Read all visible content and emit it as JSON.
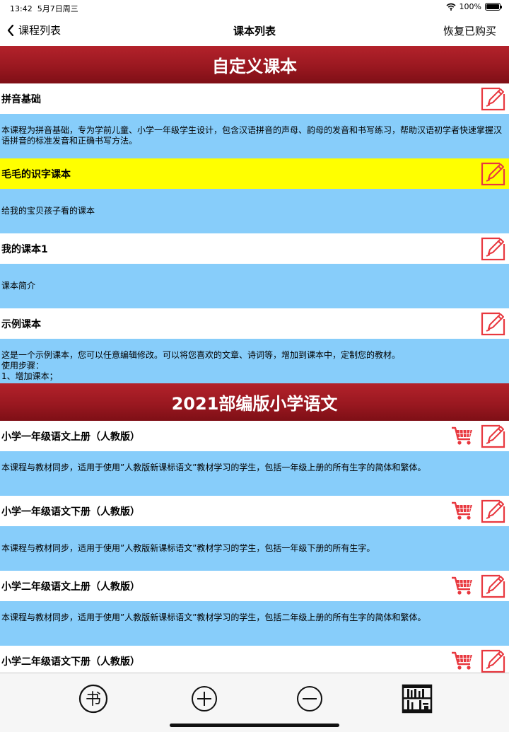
{
  "status_bar": {
    "time": "13:42",
    "date": "5月7日周三",
    "battery": "100%"
  },
  "nav": {
    "back_label": "课程列表",
    "title": "课本列表",
    "restore_label": "恢复已购买"
  },
  "sections": [
    {
      "header": "自定义课本",
      "items": [
        {
          "title": "拼音基础",
          "description": "本课程为拼音基础，专为学前儿童、小学一年级学生设计，包含汉语拼音的声母、韵母的发音和书写练习，帮助汉语初学者快速掌握汉语拼音的标准发音和正确书写方法。",
          "highlighted": false,
          "cart": false
        },
        {
          "title": "毛毛的识字课本",
          "description": "给我的宝贝孩子看的课本",
          "highlighted": true,
          "cart": false
        },
        {
          "title": "我的课本1",
          "description": "课本简介",
          "highlighted": false,
          "cart": false
        },
        {
          "title": "示例课本",
          "description": "这是一个示例课本，您可以任意编辑修改。可以将您喜欢的文章、诗词等，增加到课本中，定制您的教材。\n使用步骤：\n1、增加课本；",
          "highlighted": false,
          "cart": false
        }
      ]
    },
    {
      "header": "2021部编版小学语文",
      "items": [
        {
          "title": "小学一年级语文上册（人教版）",
          "description": "本课程与教材同步，适用于使用”人教版新课标语文”教材学习的学生，包括一年级上册的所有生字的简体和繁体。",
          "highlighted": false,
          "cart": true
        },
        {
          "title": "小学一年级语文下册（人教版）",
          "description": "本课程与教材同步，适用于使用”人教版新课标语文”教材学习的学生，包括一年级下册的所有生字。",
          "highlighted": false,
          "cart": true
        },
        {
          "title": "小学二年级语文上册（人教版）",
          "description": "本课程与教材同步，适用于使用”人教版新课标语文”教材学习的学生，包括二年级上册的所有生字的简体和繁体。",
          "highlighted": false,
          "cart": true
        },
        {
          "title": "小学二年级语文下册（人教版）",
          "description": "",
          "highlighted": false,
          "cart": true
        }
      ]
    }
  ],
  "tab_bar": {
    "book_glyph": "书",
    "items": [
      "book-icon",
      "plus-circle-icon",
      "minus-circle-icon",
      "bookshelf-icon"
    ]
  },
  "colors": {
    "header_red": "#9a1820",
    "desc_blue": "#87cdfa",
    "highlight_yellow": "#ffff00",
    "icon_red": "#e8383f"
  }
}
